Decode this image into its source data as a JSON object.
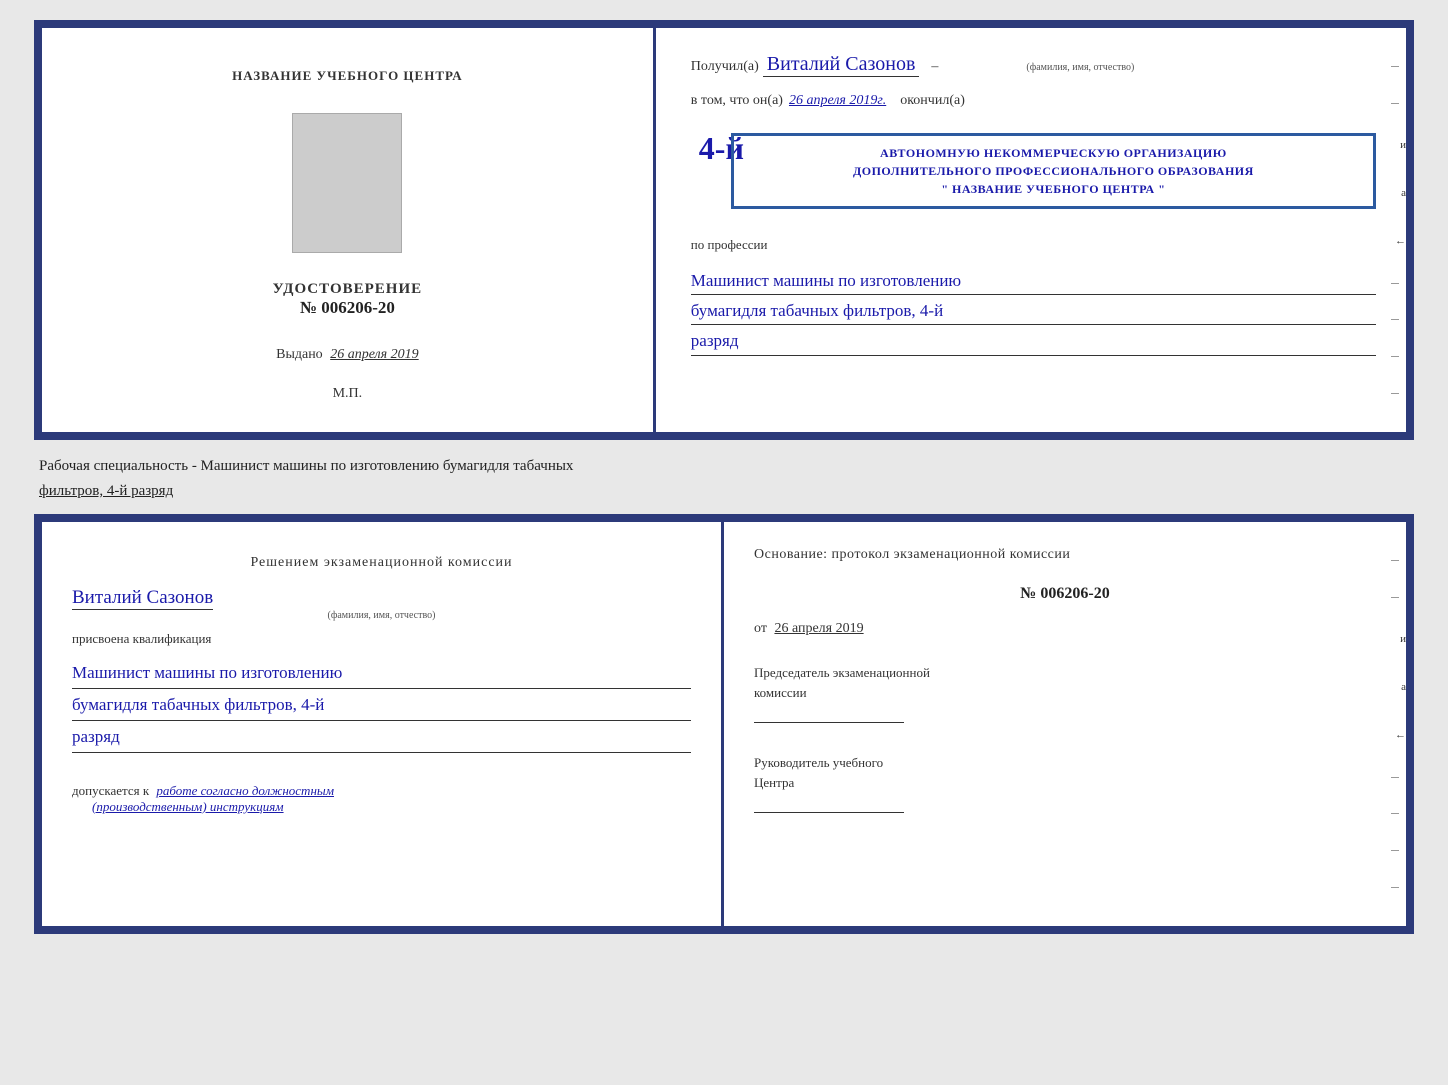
{
  "topDoc": {
    "left": {
      "title": "НАЗВАНИЕ УЧЕБНОГО ЦЕНТРА",
      "udostoverenie": "УДОСТОВЕРЕНИЕ",
      "number": "№ 006206-20",
      "vydano_label": "Выдано",
      "vydano_date": "26 апреля 2019",
      "mp": "М.П."
    },
    "right": {
      "poluchil_prefix": "Получил(а)",
      "name": "Виталий  Сазонов",
      "name_sublabel": "(фамилия, имя, отчество)",
      "dash": "–",
      "vtom_prefix": "в том, что он(а)",
      "date_handwritten": "26 апреля 2019г.",
      "okonchil": "окончил(а)",
      "stamp_num": "4-й",
      "stamp_line1": "АВТОНОМНУЮ НЕКОММЕРЧЕСКУЮ ОРГАНИЗАЦИЮ",
      "stamp_line2": "ДОПОЛНИТЕЛЬНОГО ПРОФЕССИОНАЛЬНОГО ОБРАЗОВАНИЯ",
      "stamp_line3": "\" НАЗВАНИЕ УЧЕБНОГО ЦЕНТРА \"",
      "i_label": "и",
      "a_label": "а",
      "left_arrow": "←",
      "po_professii": "по профессии",
      "profession_line1": "Машинист машины по изготовлению",
      "profession_line2": "бумагидля табачных фильтров, 4-й",
      "profession_line3": "разряд"
    }
  },
  "infoText": {
    "line1": "Рабочая специальность - Машинист машины по изготовлению бумагидля табачных",
    "line2": "фильтров, 4-й разряд"
  },
  "bottomDoc": {
    "left": {
      "title": "Решением  экзаменационной  комиссии",
      "name": "Виталий  Сазонов",
      "name_sublabel": "(фамилия, имя, отчество)",
      "prisvoena": "присвоена квалификация",
      "profession_line1": "Машинист машины по изготовлению",
      "profession_line2": "бумагидля табачных фильтров, 4-й",
      "profession_line3": "разряд",
      "dopuskaetsya_prefix": "допускается к",
      "dopuskaetsya_text": "работе согласно должностным",
      "dopuskaetsya_text2": "(производственным) инструкциям"
    },
    "right": {
      "osnovanie": "Основание: протокол экзаменационной  комиссии",
      "number": "№  006206-20",
      "ot_label": "от",
      "date": "26 апреля 2019",
      "predsedatel_label": "Председатель экзаменационной",
      "komissii_label": "комиссии",
      "rukovoditel_label": "Руководитель учебного",
      "tsentr_label": "Центра",
      "i_label": "и",
      "a_label": "а",
      "left_arrow": "←"
    }
  }
}
